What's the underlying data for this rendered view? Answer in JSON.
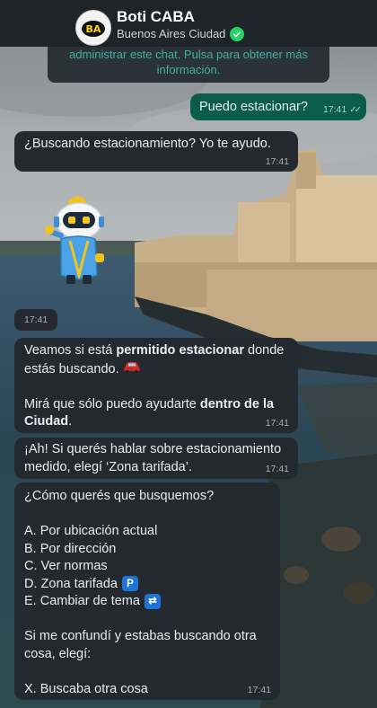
{
  "header": {
    "title": "Boti CABA",
    "subtitle": "Buenos Aires Ciudad",
    "avatar_text": "BA",
    "verified_icon": "verified-check-icon",
    "accent_color": "#25d366"
  },
  "system_note": {
    "line1": "administrar este chat. Pulsa para obtener más",
    "line2": "información."
  },
  "messages": {
    "m1": {
      "text": "Puedo estacionar?",
      "time": "17:41",
      "status": "read"
    },
    "m2": {
      "text": "¿Buscando estacionamiento? Yo te ayudo.",
      "time": "17:41"
    },
    "m3": {
      "time": "17:41",
      "sticker": "boti-robot-sticker"
    },
    "m4": {
      "p1a": "Veamos si está ",
      "p1b": "permitido estacionar",
      "p1c": " donde",
      "p1d": "estás buscando.",
      "p1_emoji": "car-icon",
      "p2a": "Mirá que sólo puedo ayudarte ",
      "p2b": "dentro de la",
      "p2c": "Ciudad",
      "p2d": ".",
      "time": "17:41"
    },
    "m5": {
      "line1": "¡Ah! Si querés hablar sobre estacionamiento",
      "line2": "medido, elegí ‘Zona tarifada’.",
      "time": "17:41"
    },
    "m6": {
      "question": "¿Cómo querés que busquemos?",
      "options": [
        "A. Por ubicación actual",
        "B. Por dirección",
        "C. Ver normas",
        "D. Zona tarifada",
        "E. Cambiar de tema"
      ],
      "option_d_icon_text": "P",
      "option_e_icon": "repeat-icon",
      "note_line1": "Si me confundí y estabas buscando otra",
      "note_line2": "cosa, elegí:",
      "escape_option": "X. Buscaba otra cosa",
      "time": "17:41"
    }
  },
  "colors": {
    "incoming_bubble": "#23292e",
    "outgoing_bubble": "#0b5d4b",
    "header_bg": "#1f2428",
    "system_text": "#3fb39a"
  }
}
